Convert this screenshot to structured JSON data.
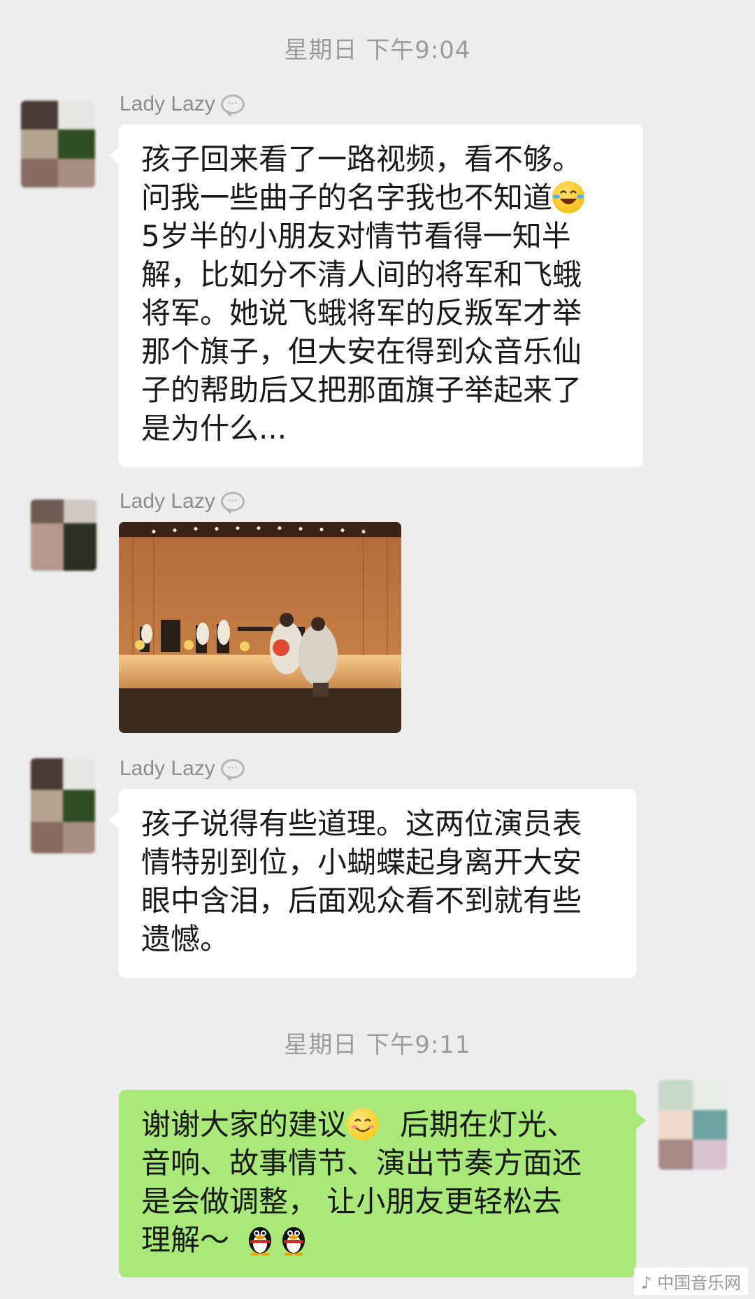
{
  "timestamps": [
    "星期日 下午9:04",
    "星期日 下午9:11"
  ],
  "messages": [
    {
      "sender": "Lady Lazy",
      "lines": [
        "孩子回来看了一路视频，看不够。",
        "问我一些曲子的名字我也不知道",
        "5岁半的小朋友对情节看得一知半",
        "解，比如分不清人间的将军和飞蛾",
        "将军。她说飞蛾将军的反叛军才举",
        "那个旗子，但大安在得到众音乐仙",
        "子的帮助后又把那面旗子举起来了",
        "是为什么..."
      ],
      "emoji": "laughing-tears"
    },
    {
      "sender": "Lady Lazy",
      "image": "stage-performance-photo"
    },
    {
      "sender": "Lady Lazy",
      "lines": [
        "孩子说得有些道理。这两位演员表",
        "情特别到位，小蝴蝶起身离开大安",
        "眼中含泪，后面观众看不到就有些",
        "遗憾。"
      ]
    },
    {
      "sender": "self",
      "lines": [
        "谢谢大家的建议",
        "后期在灯光、",
        "音响、故事情节、演出节奏方面还",
        "是会做调整， 让小朋友更轻松去",
        "理解～"
      ],
      "emoji": [
        "smiling",
        "penguin",
        "penguin"
      ]
    }
  ],
  "watermark": "中国音乐网",
  "colors": {
    "background": "#ededed",
    "incoming_bubble": "#ffffff",
    "outgoing_bubble": "#a9e97a",
    "meta_text": "#9b9b9b"
  }
}
